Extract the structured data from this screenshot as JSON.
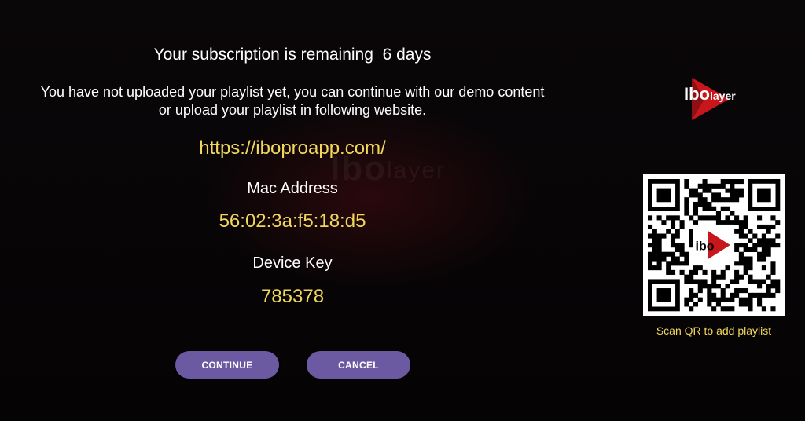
{
  "watermark": {
    "brand_prefix": "Ibo",
    "brand_suffix": "layer"
  },
  "subscription": {
    "text": "Your subscription is remaining  6 days"
  },
  "info": {
    "text": "You have not uploaded your playlist yet, you can continue with our demo content or upload your playlist in following website."
  },
  "website": {
    "url": "https://iboproapp.com/"
  },
  "device": {
    "mac_label": "Mac Address",
    "mac_value": "56:02:3a:f5:18:d5",
    "key_label": "Device Key",
    "key_value": "785378"
  },
  "buttons": {
    "continue_label": "CONTINUE",
    "cancel_label": "CANCEL"
  },
  "logo": {
    "prefix": "Ibo",
    "suffix": "layer",
    "play_color": "#c8161d"
  },
  "qr": {
    "caption": "Scan QR to add playlist",
    "center_logo_text": "ibo"
  },
  "colors": {
    "accent_yellow": "#f1d85a",
    "button_purple": "#6b5aa1",
    "brand_red": "#c8161d"
  }
}
